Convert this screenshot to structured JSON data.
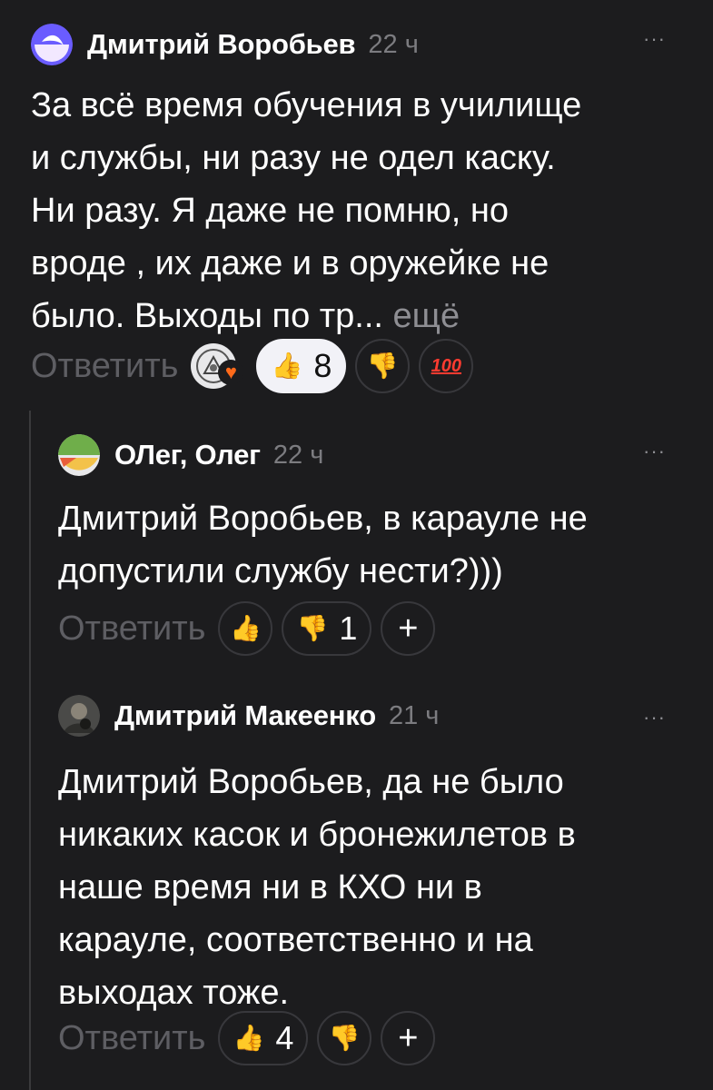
{
  "comments": [
    {
      "author": "Дмитрий Воробьев",
      "time": "22 ч",
      "more": "···",
      "text_lines": [
        "За всё время обучения в училище",
        "и службы, ни разу не одел каску.",
        "Ни разу. Я даже не помню, но",
        "вроде , их даже и в оружейке не",
        "было. Выходы по тр..."
      ],
      "more_link": "ещё",
      "reply_label": "Ответить",
      "like_count": "8",
      "reactions": [
        "thumbs-up",
        "thumbs-down",
        "hundred"
      ]
    },
    {
      "author": "ОЛег, Олег",
      "time": "22 ч",
      "more": "···",
      "text_lines": [
        "Дмитрий Воробьев, в карауле не",
        "допустили службу нести?)))"
      ],
      "reply_label": "Ответить",
      "dislike_count": "1",
      "plus": "+"
    },
    {
      "author": "Дмитрий Макеенко",
      "time": "21 ч",
      "more": "···",
      "text_lines": [
        "Дмитрий Воробьев, да не было",
        "никаких касок и бронежилетов в",
        "наше время ни в КХО ни в",
        "карауле, соответственно и на",
        "выходах тоже."
      ],
      "reply_label": "Ответить",
      "like_count": "4",
      "plus": "+"
    }
  ],
  "icons": {
    "like": "👍",
    "dislike": "👎",
    "hundred": "100",
    "heart": "♥"
  },
  "colors": {
    "background": "#1c1c1e",
    "muted": "#7c7c80",
    "active_pill": "#f2f2f7"
  }
}
